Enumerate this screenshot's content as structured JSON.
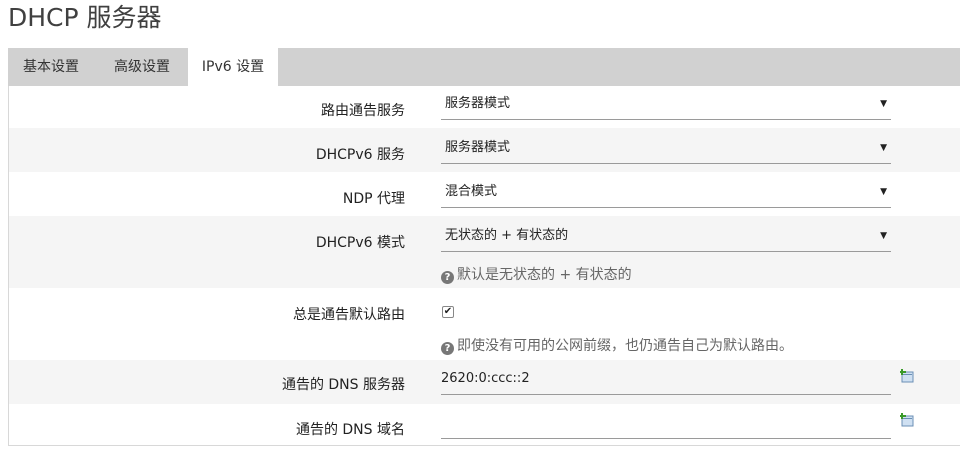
{
  "page": {
    "title": "DHCP 服务器"
  },
  "tabs": [
    {
      "label": "基本设置"
    },
    {
      "label": "高级设置"
    },
    {
      "label": "IPv6 设置"
    }
  ],
  "form": {
    "ra": {
      "label": "路由通告服务",
      "value": "服务器模式"
    },
    "dhcpv6": {
      "label": "DHCPv6 服务",
      "value": "服务器模式"
    },
    "ndp": {
      "label": "NDP 代理",
      "value": "混合模式"
    },
    "ra_management": {
      "label": "DHCPv6 模式",
      "value": "无状态的 + 有状态的",
      "help": "默认是无状态的 + 有状态的"
    },
    "ra_default": {
      "label": "总是通告默认路由",
      "checked": true,
      "help": "即使没有可用的公网前缀，也仍通告自己为默认路由。"
    },
    "dns": {
      "label": "通告的 DNS 服务器",
      "value": "2620:0:ccc::2"
    },
    "domain": {
      "label": "通告的 DNS 域名",
      "value": ""
    }
  },
  "icons": {
    "help": "help-circle-icon",
    "add": "add-entry-icon",
    "caret": "caret-down-icon"
  }
}
